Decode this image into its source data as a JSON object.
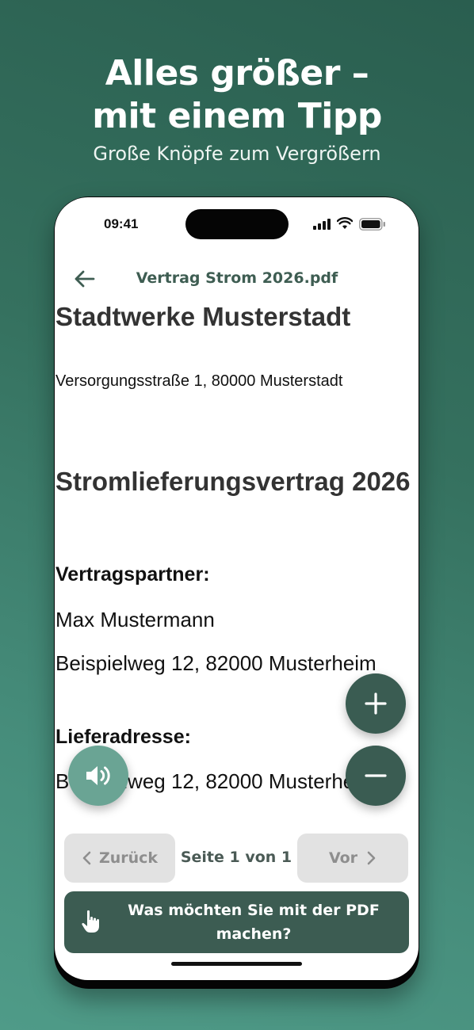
{
  "promo": {
    "title_line1": "Alles größer –",
    "title_line2": "mit einem Tipp",
    "subtitle": "Große Knöpfe zum Vergrößern"
  },
  "status_bar": {
    "time": "09:41",
    "icons": [
      "signal-icon",
      "wifi-icon",
      "battery-icon"
    ]
  },
  "header": {
    "back_icon": "arrow-left-icon",
    "title": "Vertrag Strom 2026.pdf"
  },
  "document": {
    "company": "Stadtwerke Musterstadt",
    "address": "Versorgungsstraße 1, 80000 Musterstadt",
    "heading": "Stromlieferungsvertrag 2026",
    "partner_label": "Vertragspartner:",
    "partner_name": "Max Mustermann",
    "partner_street": "Beispielweg 12, 82000 Musterheim",
    "delivery_label": "Lieferadresse:",
    "delivery_street": "Beispielweg 12, 82000 Musterheim"
  },
  "controls": {
    "zoom_in_icon": "plus-icon",
    "zoom_out_icon": "minus-icon",
    "speak_icon": "speaker-icon"
  },
  "pagination": {
    "prev_label": "Zurück",
    "next_label": "Vor",
    "indicator": "Seite 1 von 1"
  },
  "action": {
    "icon": "hand-pointer-icon",
    "label": "Was möchten Sie mit der PDF machen?"
  },
  "colors": {
    "accent": "#3c5c52",
    "speaker_button": "#6aa494",
    "header_text": "#3e5d52",
    "disabled_button": "#e2e2e2"
  }
}
